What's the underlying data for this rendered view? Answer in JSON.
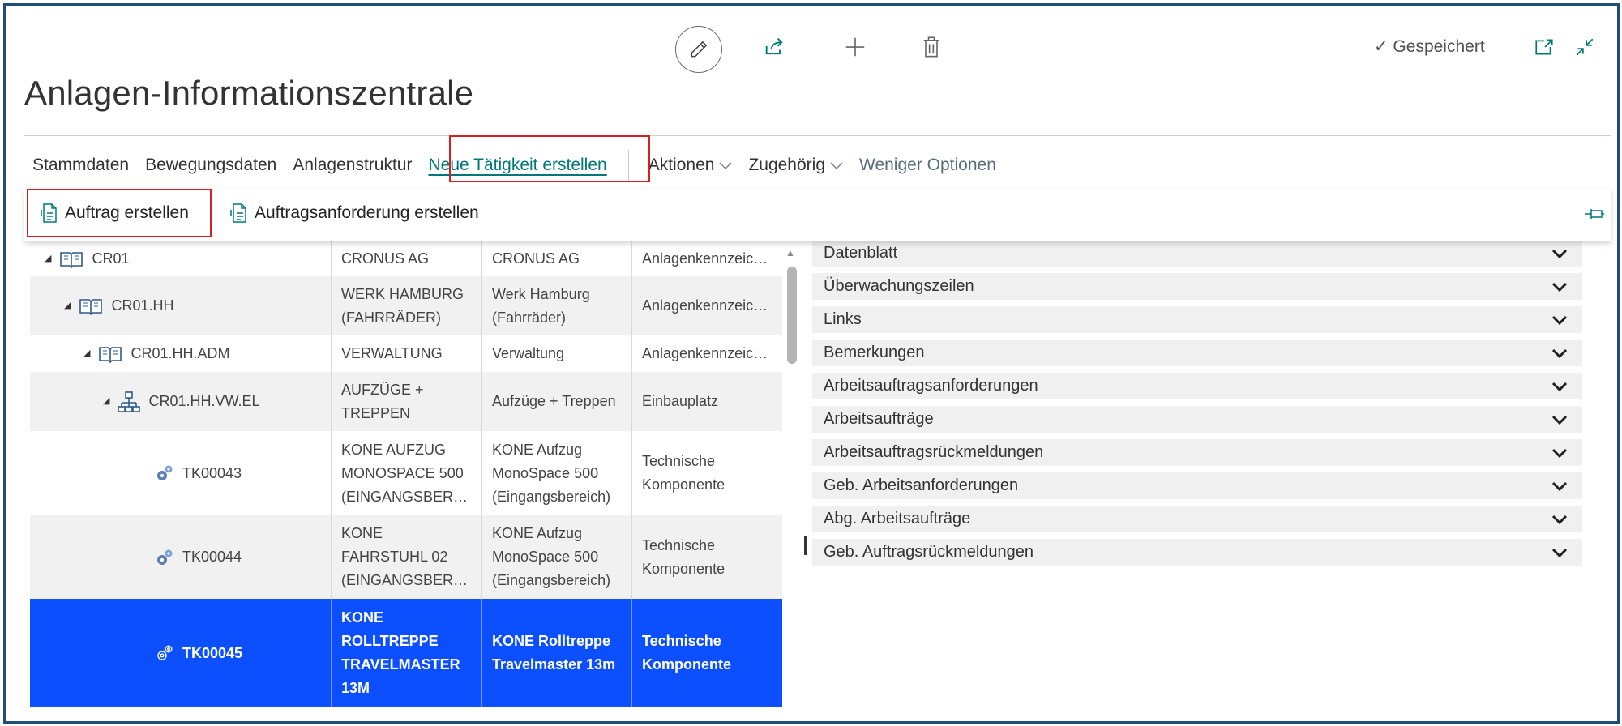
{
  "toolbar": {
    "icons": [
      "edit-icon",
      "share-icon",
      "plus-icon",
      "delete-icon"
    ],
    "status": "✓ Gespeichert",
    "right_icons": [
      "open-new-window-icon",
      "collapse-icon"
    ]
  },
  "page": {
    "title": "Anlagen-Informationszentrale"
  },
  "nav": {
    "items": [
      {
        "label": "Stammdaten"
      },
      {
        "label": "Bewegungsdaten"
      },
      {
        "label": "Anlagenstruktur"
      },
      {
        "label": "Neue Tätigkeit erstellen"
      },
      {
        "label": "Aktionen"
      },
      {
        "label": "Zugehörig"
      },
      {
        "label": "Weniger Optionen"
      }
    ]
  },
  "actions": {
    "items": [
      {
        "label": "Auftrag erstellen",
        "icon": "document-icon"
      },
      {
        "label": "Auftragsanforderung erstellen",
        "icon": "document-icon"
      }
    ],
    "pin_icon": "pin-icon"
  },
  "grid": {
    "rows": [
      {
        "code": "CR01",
        "name": "CRONUS AG",
        "desc": "CRONUS AG",
        "type": "Anlagenkennzeic…",
        "icon": "book-icon",
        "expanded": "true"
      },
      {
        "code": "CR01.HH",
        "name": "WERK HAMBURG (FAHRRÄDER)",
        "desc": "Werk Hamburg (Fahrräder)",
        "type": "Anlagenkennzeic…",
        "icon": "book-icon",
        "expanded": "true"
      },
      {
        "code": "CR01.HH.ADM",
        "name": "VERWALTUNG",
        "desc": "Verwaltung",
        "type": "Anlagenkennzeic…",
        "icon": "book-icon",
        "expanded": "true"
      },
      {
        "code": "CR01.HH.VW.EL",
        "name": "AUFZÜGE + TREPPEN",
        "desc": "Aufzüge + Treppen",
        "type": "Einbauplatz",
        "icon": "hierarchy-icon",
        "expanded": "true"
      },
      {
        "code": "TK00043",
        "name": "KONE AUFZUG MONOSPACE 500 (EINGANGSBER…",
        "desc": "KONE Aufzug MonoSpace 500 (Eingangsbereich)",
        "type": "Technische Komponente",
        "icon": "gears-icon"
      },
      {
        "code": "TK00044",
        "name": "KONE FAHRSTUHL 02 (EINGANGSBER…",
        "desc": "KONE Aufzug MonoSpace 500 (Eingangsbereich)",
        "type": "Technische Komponente",
        "icon": "gears-icon"
      },
      {
        "code": "TK00045",
        "name": "KONE ROLLTREPPE TRAVELMASTER 13M",
        "desc": "KONE Rolltreppe Travelmaster 13m",
        "type": "Technische Komponente",
        "icon": "gears-icon",
        "selected": "true"
      }
    ]
  },
  "factboxes": {
    "items": [
      {
        "label": "Datenblatt"
      },
      {
        "label": "Überwachungszeilen"
      },
      {
        "label": "Links"
      },
      {
        "label": "Bemerkungen"
      },
      {
        "label": "Arbeitsauftragsanforderungen"
      },
      {
        "label": "Arbeitsaufträge"
      },
      {
        "label": "Arbeitsauftragsrückmeldungen"
      },
      {
        "label": "Geb. Arbeitsanforderungen"
      },
      {
        "label": "Abg. Arbeitsaufträge"
      },
      {
        "label": "Geb. Auftragsrückmeldungen"
      }
    ],
    "expand_icon": "chevron-down-icon"
  },
  "colors": {
    "accent": "#00787a",
    "selection": "#0b4fff",
    "highlight_box": "#d42020",
    "frame": "#1f4e79"
  }
}
